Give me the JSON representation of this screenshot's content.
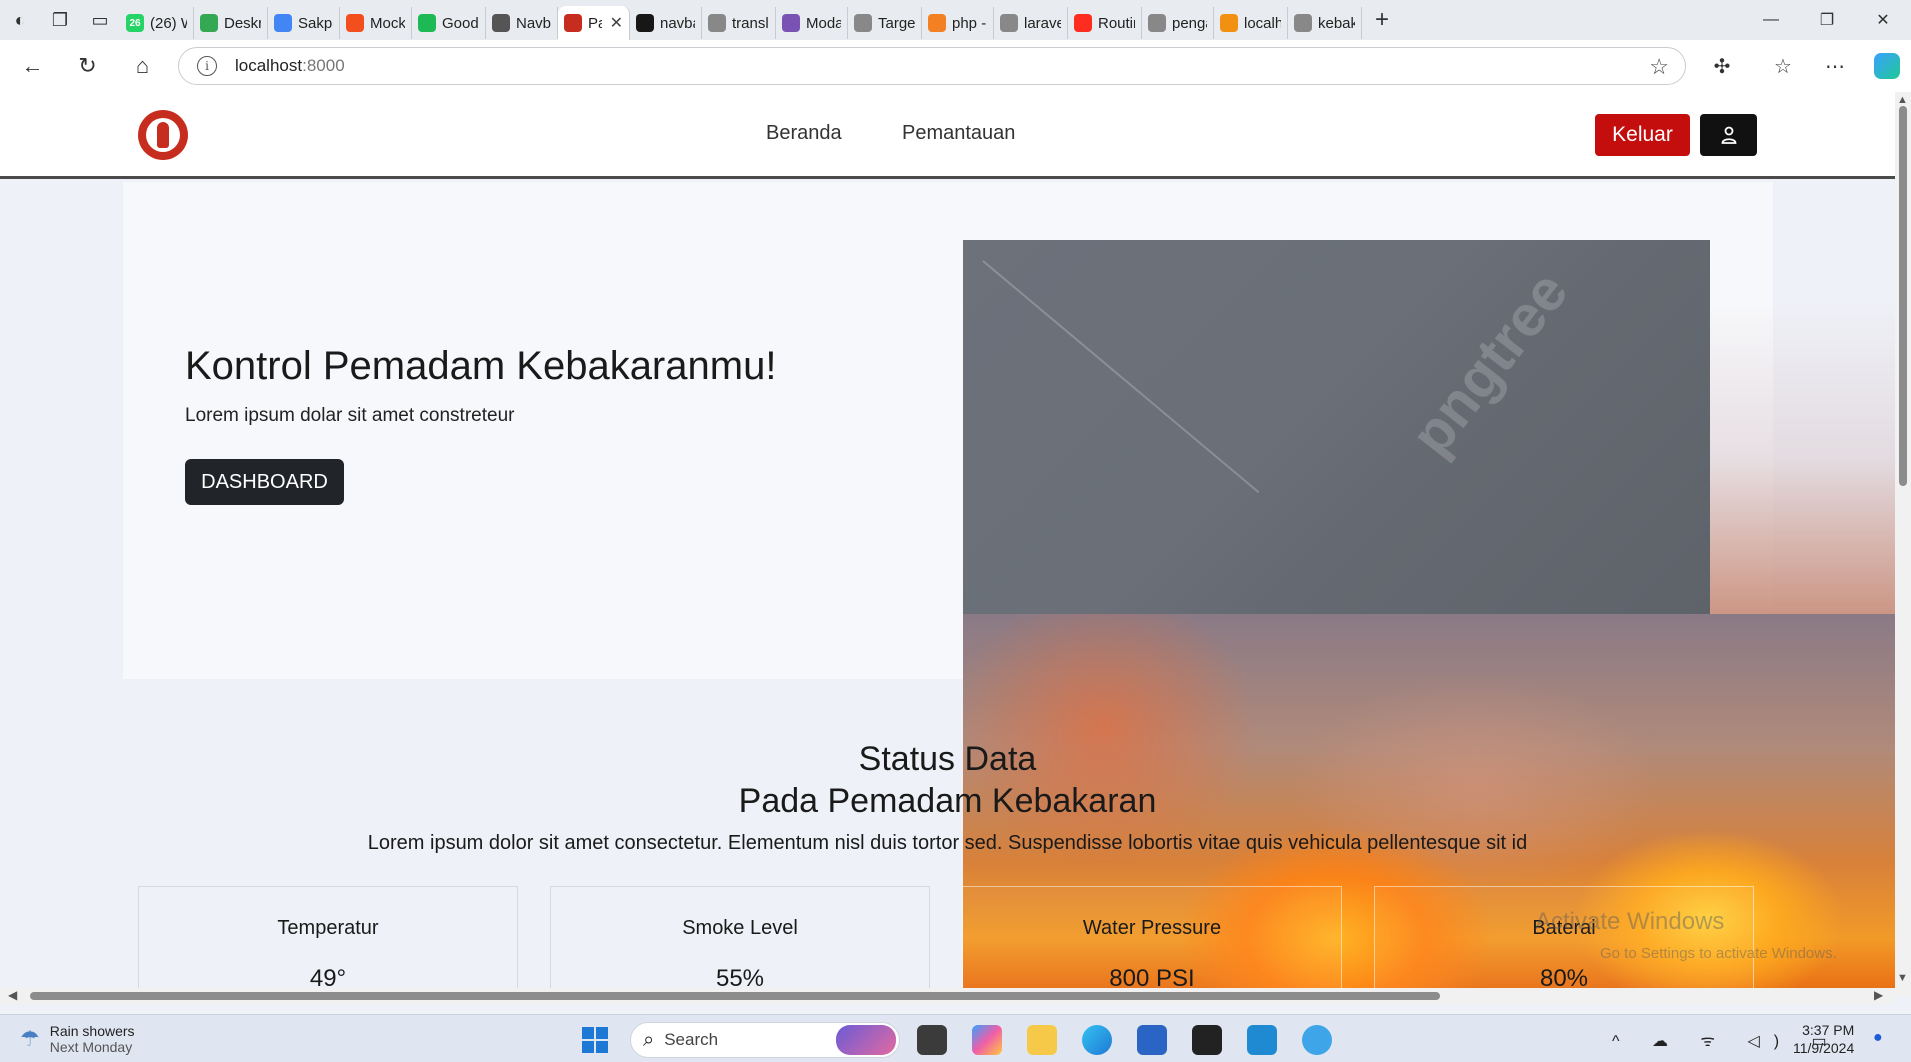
{
  "browser": {
    "tabs": [
      {
        "label": "(26) W",
        "color": "#25d366",
        "icon": "whatsapp-icon",
        "badge": "26"
      },
      {
        "label": "Deskri",
        "color": "#34a853",
        "icon": "sheets-icon"
      },
      {
        "label": "Sakpo",
        "color": "#4285f4",
        "icon": "docs-icon"
      },
      {
        "label": "Mocku",
        "color": "#f24e1e",
        "icon": "figma-icon"
      },
      {
        "label": "Good I",
        "color": "#1db954",
        "icon": "spotify-icon"
      },
      {
        "label": "Navba",
        "color": "#555555",
        "icon": "openai-icon"
      },
      {
        "label": "Pa",
        "color": "#c62d1f",
        "icon": "fire-extinguisher-icon",
        "active": true
      },
      {
        "label": "navba",
        "color": "#181717",
        "icon": "github-icon"
      },
      {
        "label": "transla",
        "color": "#888888",
        "icon": "search-icon"
      },
      {
        "label": "Modal",
        "color": "#7952b3",
        "icon": "bootstrap-icon"
      },
      {
        "label": "Target",
        "color": "#888888",
        "icon": "search-icon"
      },
      {
        "label": "php -",
        "color": "#f48024",
        "icon": "stackoverflow-icon"
      },
      {
        "label": "laravel",
        "color": "#888888",
        "icon": "search-icon"
      },
      {
        "label": "Routin",
        "color": "#ff2d20",
        "icon": "laravel-icon"
      },
      {
        "label": "penga",
        "color": "#888888",
        "icon": "search-icon"
      },
      {
        "label": "localho",
        "color": "#f29111",
        "icon": "phpmyadmin-icon"
      },
      {
        "label": "kebaka",
        "color": "#888888",
        "icon": "search-icon"
      }
    ],
    "url_host": "localhost",
    "url_port": ":8000"
  },
  "site": {
    "nav": {
      "links": [
        "Beranda",
        "Pemantauan"
      ],
      "logout_label": "Keluar"
    },
    "hero": {
      "title": "Kontrol Pemadam Kebakaranmu!",
      "subtitle": "Lorem ipsum dolar sit amet constreteur",
      "button_label": "DASHBOARD",
      "watermark": "pngtree"
    },
    "status": {
      "title_line1": "Status Data",
      "title_line2": "Pada Pemadam Kebakaran",
      "description": "Lorem ipsum dolor sit amet consectetur. Elementum nisl duis tortor sed. Suspendisse lobortis vitae quis vehicula pellentesque sit id",
      "cards": [
        {
          "label": "Temperatur",
          "value": "49°"
        },
        {
          "label": "Smoke Level",
          "value": "55%"
        },
        {
          "label": "Water Pressure",
          "value": "800 PSI"
        },
        {
          "label": "Baterai",
          "value": "80%"
        }
      ]
    },
    "watermark_activate": "Activate Windows",
    "watermark_activate_sub": "Go to Settings to activate Windows."
  },
  "taskbar": {
    "weather_title": "Rain showers",
    "weather_sub": "Next Monday",
    "search_placeholder": "Search",
    "time": "3:37 PM",
    "date": "11/9/2024"
  }
}
